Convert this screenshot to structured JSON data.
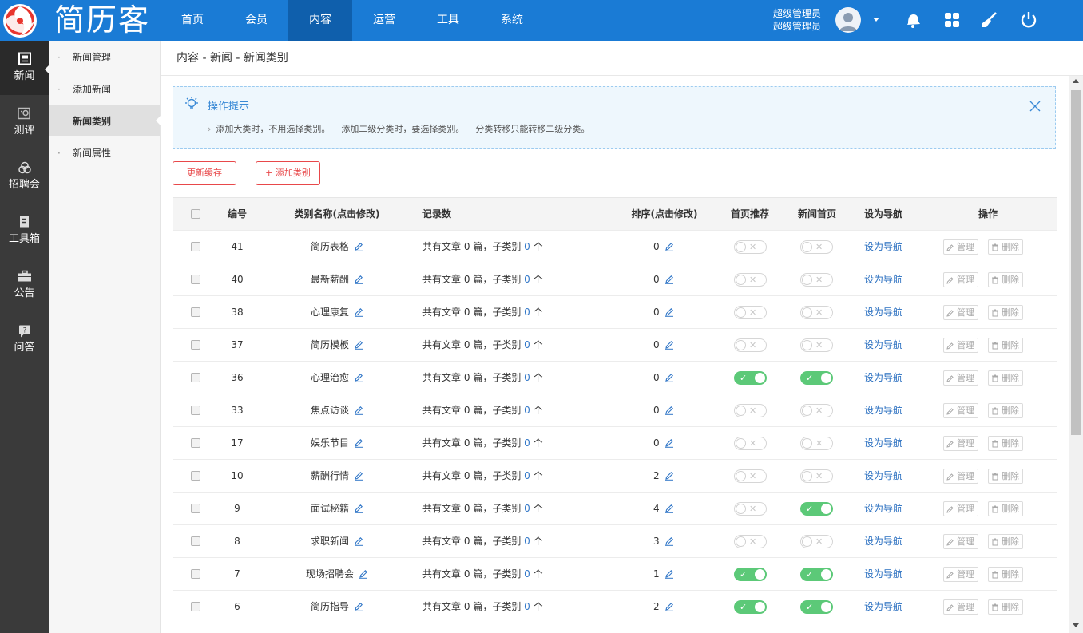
{
  "app": {
    "logo_text": "简历客"
  },
  "topnav": [
    {
      "label": "首页",
      "active": false
    },
    {
      "label": "会员",
      "active": false
    },
    {
      "label": "内容",
      "active": true
    },
    {
      "label": "运营",
      "active": false
    },
    {
      "label": "工具",
      "active": false
    },
    {
      "label": "系统",
      "active": false
    }
  ],
  "user": {
    "role": "超级管理员",
    "name": "超级管理员"
  },
  "iconbar": [
    {
      "label": "新闻",
      "icon": "news-icon",
      "active": true
    },
    {
      "label": "测评",
      "icon": "assessment-icon",
      "active": false
    },
    {
      "label": "招聘会",
      "icon": "jobfair-icon",
      "active": false
    },
    {
      "label": "工具箱",
      "icon": "toolbox-icon",
      "active": false
    },
    {
      "label": "公告",
      "icon": "notice-icon",
      "active": false
    },
    {
      "label": "问答",
      "icon": "qa-icon",
      "active": false
    }
  ],
  "subnav": [
    {
      "label": "新闻管理",
      "active": false
    },
    {
      "label": "添加新闻",
      "active": false
    },
    {
      "label": "新闻类别",
      "active": true
    },
    {
      "label": "新闻属性",
      "active": false
    }
  ],
  "breadcrumb": "内容 - 新闻 - 新闻类别",
  "tip": {
    "title": "操作提示",
    "items": [
      "添加大类时，不用选择类别。",
      "添加二级分类时，要选择类别。",
      "分类转移只能转移二级分类。"
    ]
  },
  "buttons": {
    "refresh_cache": "更新缓存",
    "add_category": "+ 添加类别"
  },
  "table": {
    "headers": {
      "id": "编号",
      "name": "类别名称(点击修改)",
      "records": "记录数",
      "order": "排序(点击修改)",
      "home_rec": "首页推荐",
      "news_home": "新闻首页",
      "set_nav": "设为导航",
      "ops": "操作"
    },
    "record_prefix": "共有文章",
    "record_mid": "篇，子类别",
    "record_suffix": "个",
    "nav_link": "设为导航",
    "op_manage": "管理",
    "op_delete": "删除",
    "rows": [
      {
        "id": "41",
        "name": "简历表格",
        "articles": "0",
        "children": "0",
        "order": "0",
        "home_rec": false,
        "news_home": false
      },
      {
        "id": "40",
        "name": "最新薪酬",
        "articles": "0",
        "children": "0",
        "order": "0",
        "home_rec": false,
        "news_home": false
      },
      {
        "id": "38",
        "name": "心理康复",
        "articles": "0",
        "children": "0",
        "order": "0",
        "home_rec": false,
        "news_home": false
      },
      {
        "id": "37",
        "name": "简历模板",
        "articles": "0",
        "children": "0",
        "order": "0",
        "home_rec": false,
        "news_home": false
      },
      {
        "id": "36",
        "name": "心理治愈",
        "articles": "0",
        "children": "0",
        "order": "0",
        "home_rec": true,
        "news_home": true
      },
      {
        "id": "33",
        "name": "焦点访谈",
        "articles": "0",
        "children": "0",
        "order": "0",
        "home_rec": false,
        "news_home": false
      },
      {
        "id": "17",
        "name": "娱乐节目",
        "articles": "0",
        "children": "0",
        "order": "0",
        "home_rec": false,
        "news_home": false
      },
      {
        "id": "10",
        "name": "薪酬行情",
        "articles": "0",
        "children": "0",
        "order": "2",
        "home_rec": false,
        "news_home": false
      },
      {
        "id": "9",
        "name": "面试秘籍",
        "articles": "0",
        "children": "0",
        "order": "4",
        "home_rec": false,
        "news_home": true
      },
      {
        "id": "8",
        "name": "求职新闻",
        "articles": "0",
        "children": "0",
        "order": "3",
        "home_rec": false,
        "news_home": false
      },
      {
        "id": "7",
        "name": "现场招聘会",
        "articles": "0",
        "children": "0",
        "order": "1",
        "home_rec": true,
        "news_home": true
      },
      {
        "id": "6",
        "name": "简历指导",
        "articles": "0",
        "children": "0",
        "order": "2",
        "home_rec": true,
        "news_home": true
      }
    ]
  },
  "colors": {
    "topbar": "#1a7bd5",
    "topnav_active": "#0f5fac",
    "accent_red": "#e8484a",
    "toggle_on": "#5cc978",
    "link_blue": "#2a6fc0"
  }
}
